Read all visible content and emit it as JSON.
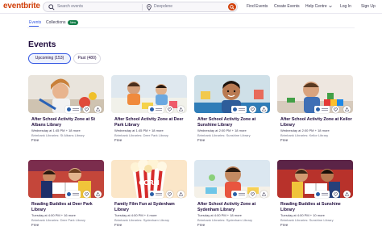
{
  "header": {
    "logo": "eventbrite",
    "search_placeholder": "Search events",
    "location": "Deepdene",
    "nav": {
      "find_events": "Find Events",
      "create_events": "Create Events",
      "help_centre": "Help Centre",
      "log_in": "Log In",
      "sign_up": "Sign Up"
    }
  },
  "tabs": {
    "events": "Events",
    "collections": "Collections",
    "new_badge": "New"
  },
  "page_title": "Events",
  "filters": {
    "upcoming": "Upcoming (153)",
    "past": "Past (480)"
  },
  "colors": {
    "brand": "#d1410c",
    "accent_blue": "#3659e3",
    "text": "#1e0a3c"
  },
  "cards": [
    {
      "title": "After School Activity Zone at St Albans Library",
      "date": "Wednesday at 1:45 PM + 18 more",
      "organizer": "Brimbank Libraries: St Albans Library",
      "price": "Free",
      "image": "child-painting"
    },
    {
      "title": "After School Activity Zone at Deer Park Library",
      "date": "Wednesday at 1:45 PM + 18 more",
      "organizer": "Brimbank Libraries: Deer Park Library",
      "price": "Free",
      "image": "children-crafting"
    },
    {
      "title": "After School Activity Zone at Sunshine Library",
      "date": "Wednesday at 2:00 PM + 18 more",
      "organizer": "Brimbank Libraries: Sunshine Library",
      "price": "Free",
      "image": "boy-smiling"
    },
    {
      "title": "After School Activity Zone at Keilor Library",
      "date": "Wednesday at 2:00 PM + 18 more",
      "organizer": "Brimbank Libraries: Keilor Library",
      "price": "Free",
      "image": "boy-building"
    },
    {
      "title": "Reading Buddies at Deer Park Library",
      "date": "Tuesday at 4:00 PM + 16 more",
      "organizer": "Brimbank Libraries: Deer Park Library",
      "price": "Free",
      "image": "kids-reading"
    },
    {
      "title": "Family Film Fun at Sydenham Library",
      "date": "Tuesday at 4:00 PM + 4 more",
      "organizer": "Brimbank Libraries: Sydenham Library",
      "price": "Free",
      "image": "popcorn"
    },
    {
      "title": "After School Activity Zone at Sydenham Library",
      "date": "Tuesday at 4:00 PM + 18 more",
      "organizer": "Brimbank Libraries: Sydenham Library",
      "price": "Free",
      "image": "boy-crafting"
    },
    {
      "title": "Reading Buddies at Sunshine Library",
      "date": "Tuesday at 4:00 PM + 10 more",
      "organizer": "Brimbank Libraries: Sunshine Library",
      "price": "Free",
      "image": "kids-reading-2"
    }
  ]
}
